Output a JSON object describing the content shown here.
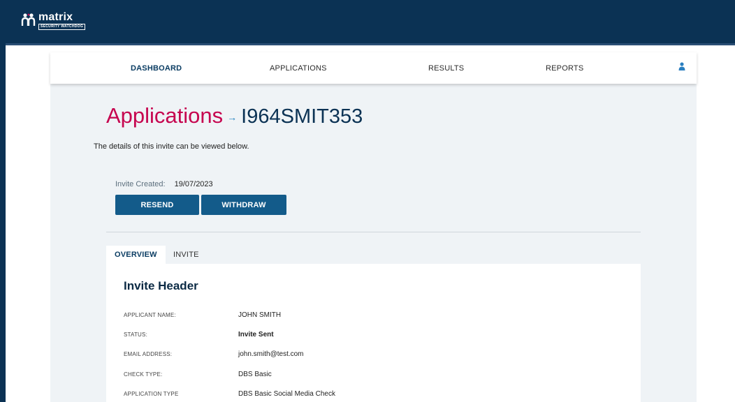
{
  "brand": {
    "name": "matrix",
    "tagline": "SECURITY WATCHDOG"
  },
  "nav": {
    "items": [
      {
        "label": "DASHBOARD",
        "active": true
      },
      {
        "label": "APPLICATIONS",
        "active": false
      },
      {
        "label": "RESULTS",
        "active": false
      },
      {
        "label": "REPORTS",
        "active": false
      }
    ],
    "user_icon": "user-icon"
  },
  "page": {
    "title": "Applications",
    "arrow": "→",
    "reference": "I964SMIT353",
    "intro": "The details of this invite can be viewed below."
  },
  "invite": {
    "created_label": "Invite Created:",
    "created_value": "19/07/2023",
    "resend_label": "RESEND",
    "withdraw_label": "WITHDRAW"
  },
  "tabs": [
    {
      "label": "OVERVIEW",
      "active": true
    },
    {
      "label": "INVITE",
      "active": false
    }
  ],
  "panel": {
    "title": "Invite Header",
    "rows": [
      {
        "label": "APPLICANT NAME:",
        "value": "JOHN SMITH"
      },
      {
        "label": "STATUS:",
        "value": "Invite Sent"
      },
      {
        "label": "EMAIL ADDRESS:",
        "value": "john.smith@test.com"
      },
      {
        "label": "CHECK TYPE:",
        "value": "DBS Basic"
      },
      {
        "label": "APPLICATION TYPE",
        "value": "DBS Basic Social Media Check"
      }
    ]
  },
  "colors": {
    "brand_navy": "#0b3254",
    "accent_pink": "#c6054f",
    "button_blue": "#135b8a",
    "content_bg": "#eff3f6"
  }
}
